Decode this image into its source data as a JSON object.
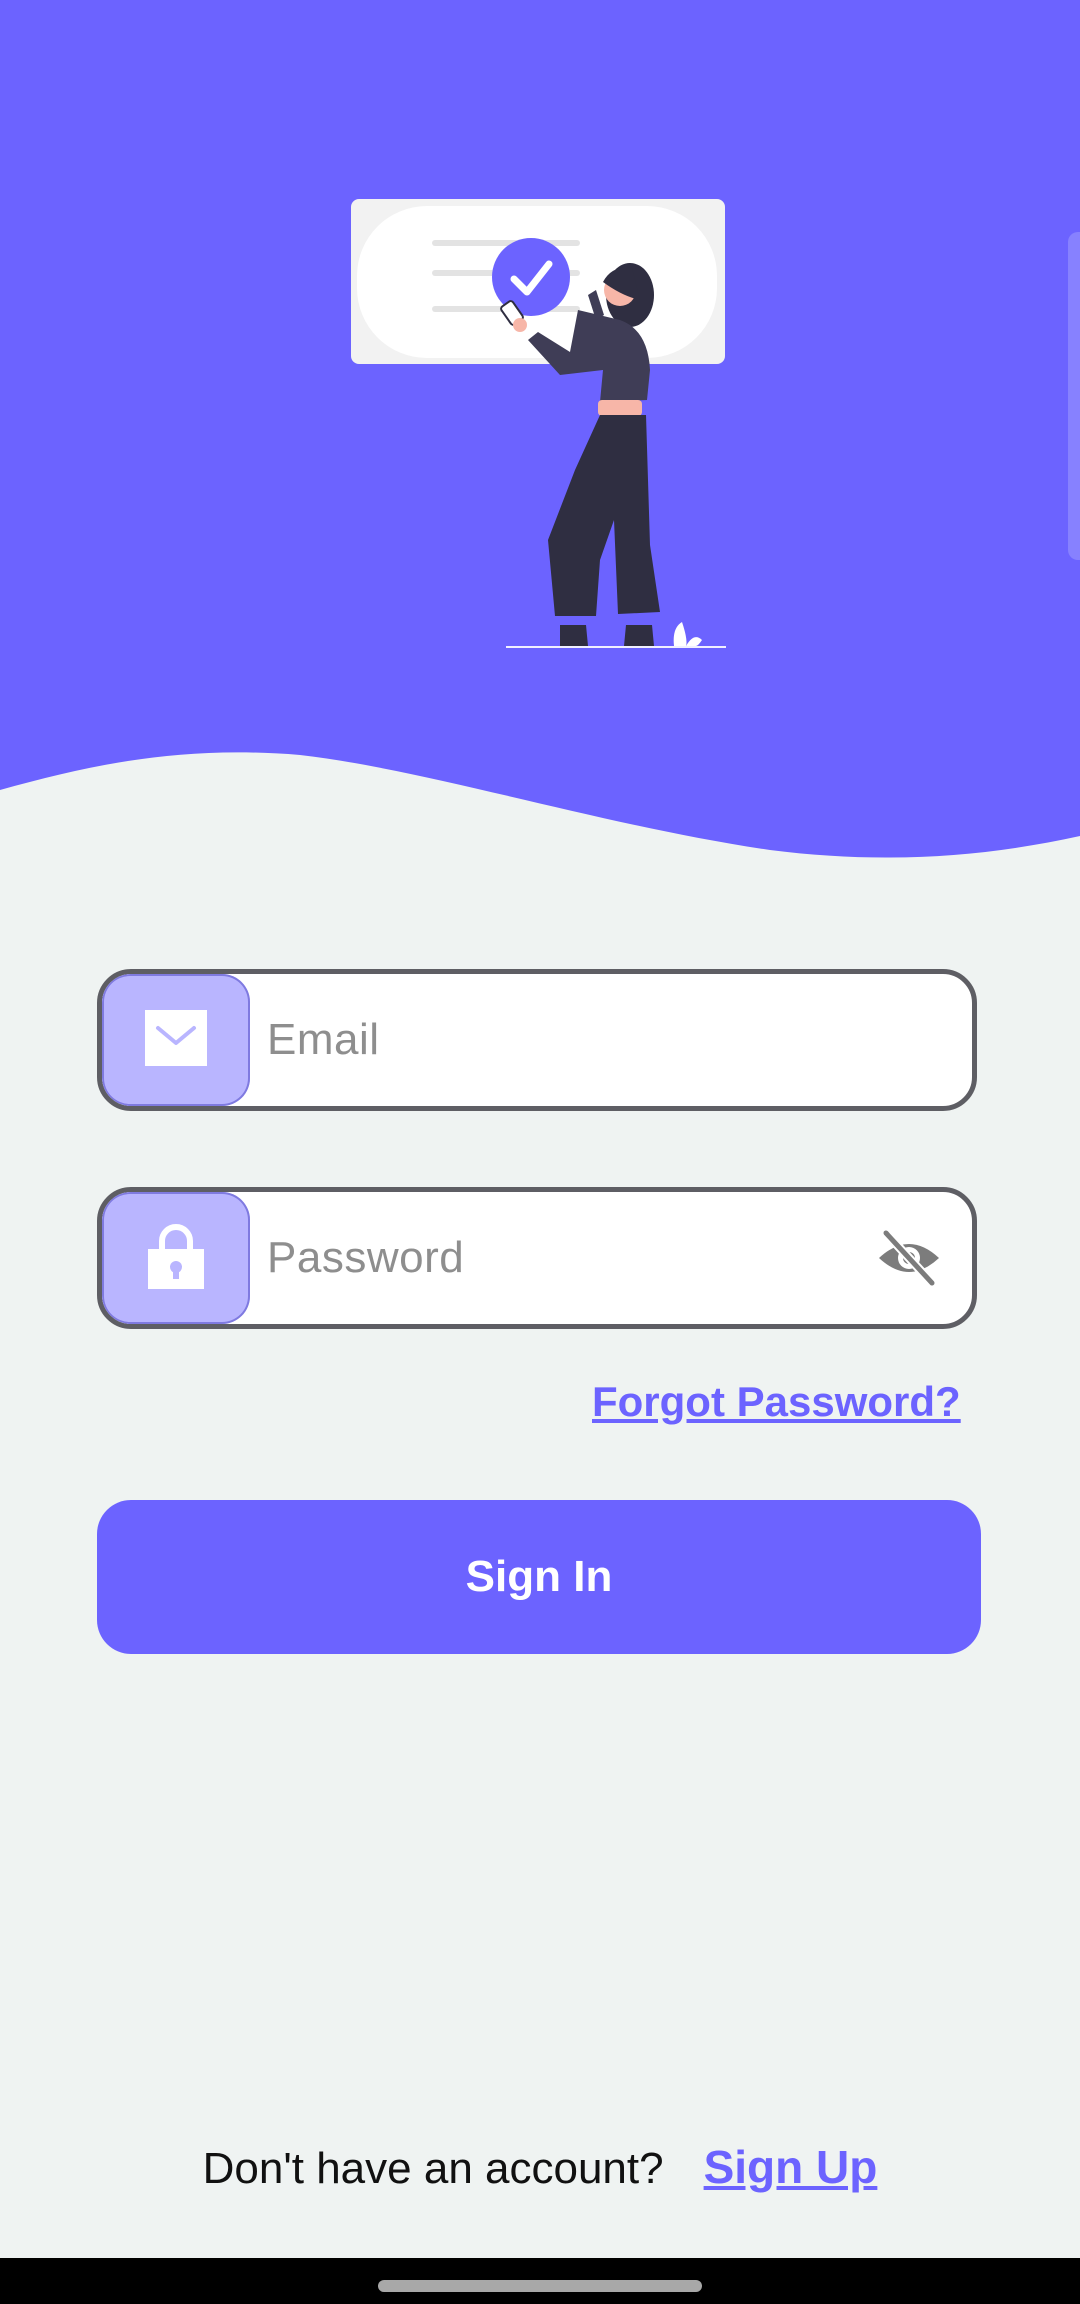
{
  "colors": {
    "brand": "#6c63ff",
    "icon_box": "#b9b5ff",
    "background": "#eff3f2",
    "field_border": "#5e5e64",
    "placeholder": "#8e8e8e"
  },
  "hero": {
    "illustration": "woman-with-checkmark-card-illustration"
  },
  "email_field": {
    "icon": "envelope-icon",
    "placeholder": "Email"
  },
  "password_field": {
    "icon": "lock-icon",
    "placeholder": "Password",
    "toggle_icon": "eye-off-icon"
  },
  "forgot_password_label": "Forgot Password?",
  "sign_in_label": "Sign In",
  "footer": {
    "prompt": "Don't have an account?",
    "sign_up_label": "Sign Up"
  }
}
